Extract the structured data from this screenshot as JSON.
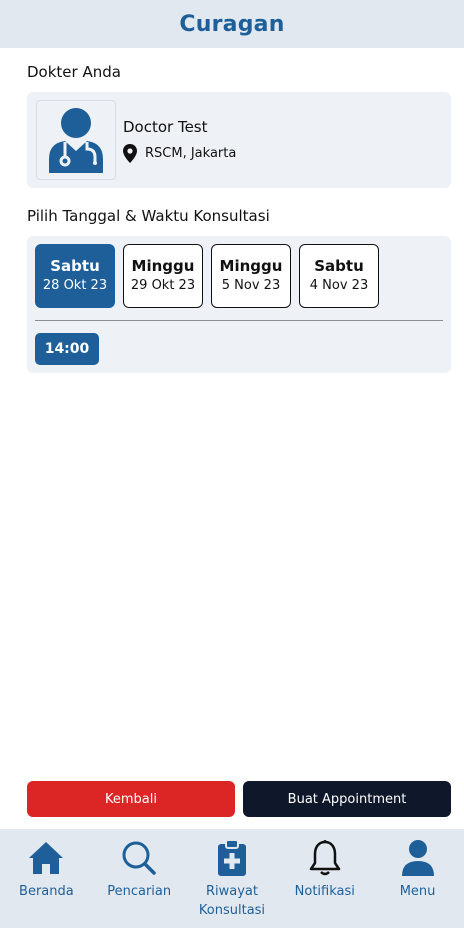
{
  "app": {
    "title": "Curagan"
  },
  "doctor_section": {
    "label": "Dokter Anda"
  },
  "doctor": {
    "name": "Doctor Test",
    "location": "RSCM, Jakarta"
  },
  "schedule_section": {
    "label": "Pilih Tanggal & Waktu Konsultasi"
  },
  "dates": [
    {
      "day": "Sabtu",
      "date": "28 Okt 23",
      "selected": true
    },
    {
      "day": "Minggu",
      "date": "29 Okt 23",
      "selected": false
    },
    {
      "day": "Minggu",
      "date": "5 Nov 23",
      "selected": false
    },
    {
      "day": "Sabtu",
      "date": "4 Nov 23",
      "selected": false
    }
  ],
  "times": [
    {
      "label": "14:00",
      "selected": true
    }
  ],
  "actions": {
    "back_label": "Kembali",
    "create_label": "Buat Appointment"
  },
  "nav": [
    {
      "label": "Beranda",
      "icon": "home-icon"
    },
    {
      "label": "Pencarian",
      "icon": "search-icon"
    },
    {
      "label": "Riwayat Konsultasi",
      "icon": "clipboard-medical-icon"
    },
    {
      "label": "Notifikasi",
      "icon": "bell-icon"
    },
    {
      "label": "Menu",
      "icon": "user-icon"
    }
  ],
  "colors": {
    "primary": "#1e5f99",
    "danger": "#dc2626",
    "dark": "#0f172a",
    "surface": "#eef2f7",
    "bar": "#e2e8f0"
  }
}
